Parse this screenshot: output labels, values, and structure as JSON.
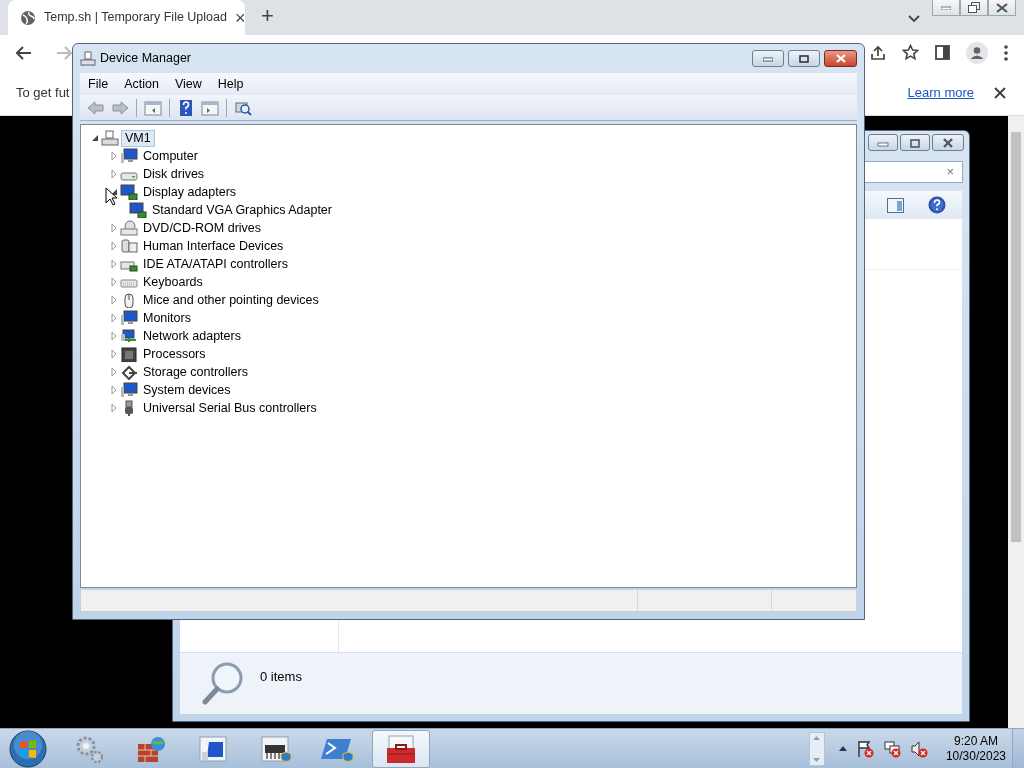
{
  "browser": {
    "tabs": [
      {
        "title": "Temp.sh | Temporary File Upload",
        "selected": true,
        "close": "×"
      }
    ],
    "new_tab": "+",
    "infobar": {
      "text": "To get fut",
      "link": "Learn more"
    }
  },
  "device_manager": {
    "title": "Device Manager",
    "menu": [
      "File",
      "Action",
      "View",
      "Help"
    ],
    "tree": {
      "label": "VM1",
      "expanded": true,
      "selected": true,
      "children": [
        {
          "label": "Computer",
          "expanded": false
        },
        {
          "label": "Disk drives",
          "expanded": false
        },
        {
          "label": "Display adapters",
          "expanded": true,
          "children": [
            {
              "label": "Standard VGA Graphics Adapter"
            }
          ]
        },
        {
          "label": "DVD/CD-ROM drives",
          "expanded": false
        },
        {
          "label": "Human Interface Devices",
          "expanded": false
        },
        {
          "label": "IDE ATA/ATAPI controllers",
          "expanded": false
        },
        {
          "label": "Keyboards",
          "expanded": false
        },
        {
          "label": "Mice and other pointing devices",
          "expanded": false
        },
        {
          "label": "Monitors",
          "expanded": false
        },
        {
          "label": "Network adapters",
          "expanded": false
        },
        {
          "label": "Processors",
          "expanded": false
        },
        {
          "label": "Storage controllers",
          "expanded": false
        },
        {
          "label": "System devices",
          "expanded": false
        },
        {
          "label": "Universal Serial Bus controllers",
          "expanded": false
        }
      ]
    }
  },
  "explorer": {
    "search_clear": "×",
    "status": "0 items"
  },
  "taskbar": {
    "time": "9:20 AM",
    "date": "10/30/2023"
  }
}
